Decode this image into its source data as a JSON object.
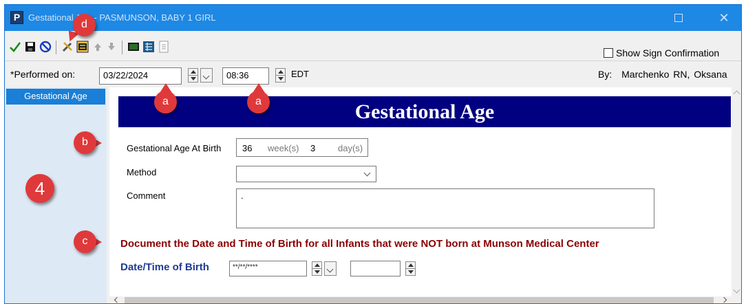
{
  "window": {
    "app_icon_letter": "P",
    "title": "Gestational Age - PASMUNSON, BABY 1 GIRL",
    "close_symbol": "✕"
  },
  "toolbar": {
    "show_sign_confirmation_label": "Show Sign Confirmation",
    "show_sign_confirmation_checked": false
  },
  "performed": {
    "label": "*Performed on:",
    "date": "03/22/2024",
    "time": "08:36",
    "timezone": "EDT",
    "by_label": "By:",
    "by_name": "Marchenko RN, Oksana"
  },
  "sidebar": {
    "items": [
      {
        "label": "Gestational Age",
        "selected": true
      }
    ]
  },
  "form": {
    "banner_title": "Gestational Age",
    "ga_at_birth_label": "Gestational Age At Birth",
    "ga_weeks_value": "36",
    "ga_weeks_unit": "week(s)",
    "ga_days_value": "3",
    "ga_days_unit": "day(s)",
    "method_label": "Method",
    "method_value": "",
    "comment_label": "Comment",
    "comment_value": ".",
    "notice": "Document the Date and Time of Birth for all Infants that were NOT born at Munson Medical Center",
    "birth_datetime_label": "Date/Time of Birth",
    "birth_date_placeholder": "**/**/****",
    "birth_time_value": ""
  },
  "annotations": {
    "a": "a",
    "b": "b",
    "c": "c",
    "d": "d",
    "four": "4"
  },
  "colors": {
    "titlebar": "#1e88e5",
    "banner": "#000080",
    "notice": "#8b0000",
    "datetime_label": "#1f3b94",
    "sidebar_selected": "#1a7fd6",
    "annotation_badge": "#e0393b"
  },
  "icons": [
    "checkmark-icon",
    "save-icon",
    "cancel-icon",
    "tools-icon",
    "calculator-form-icon",
    "arrow-up-icon",
    "arrow-down-icon",
    "terminal-icon",
    "grid-icon",
    "document-icon"
  ]
}
